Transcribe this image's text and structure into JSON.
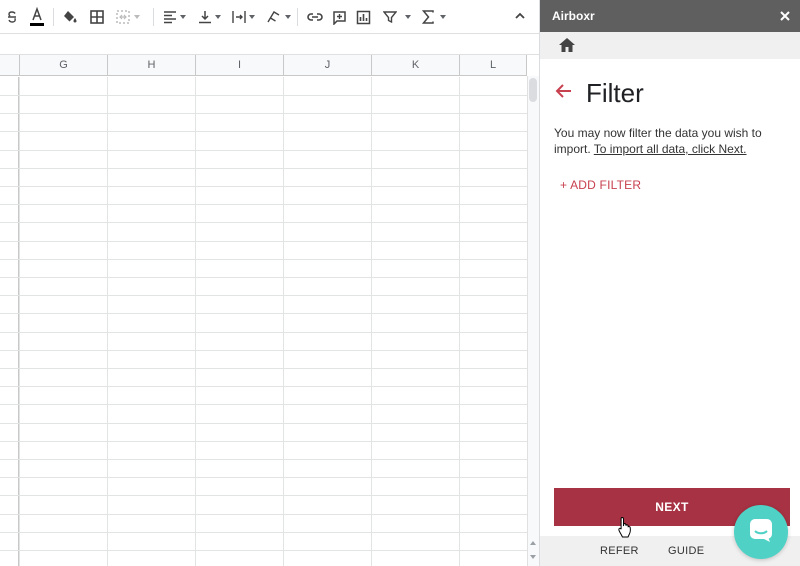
{
  "spreadsheet": {
    "columns": [
      "G",
      "H",
      "I",
      "J",
      "K",
      "L"
    ],
    "toolbar_icons": [
      "strikethrough-icon",
      "text-color-icon",
      "fill-color-icon",
      "borders-icon",
      "merge-cells-icon",
      "horizontal-align-icon",
      "vertical-align-icon",
      "text-wrap-icon",
      "text-rotation-icon",
      "insert-link-icon",
      "insert-comment-icon",
      "insert-chart-icon",
      "filter-icon",
      "functions-icon"
    ]
  },
  "panel": {
    "app_name": "Airboxr",
    "page_title": "Filter",
    "description": "You may now filter the data you wish to import. ",
    "description_link": "To import all data, click Next.",
    "add_filter_label": "+ ADD FILTER",
    "next_label": "NEXT",
    "footer": {
      "refer_label": "REFER",
      "guide_label": "GUIDE"
    }
  },
  "colors": {
    "header_bg": "#5f5f5f",
    "accent": "#c8414f",
    "next_button": "#a73243",
    "chat_bubble": "#4fd1c5"
  }
}
